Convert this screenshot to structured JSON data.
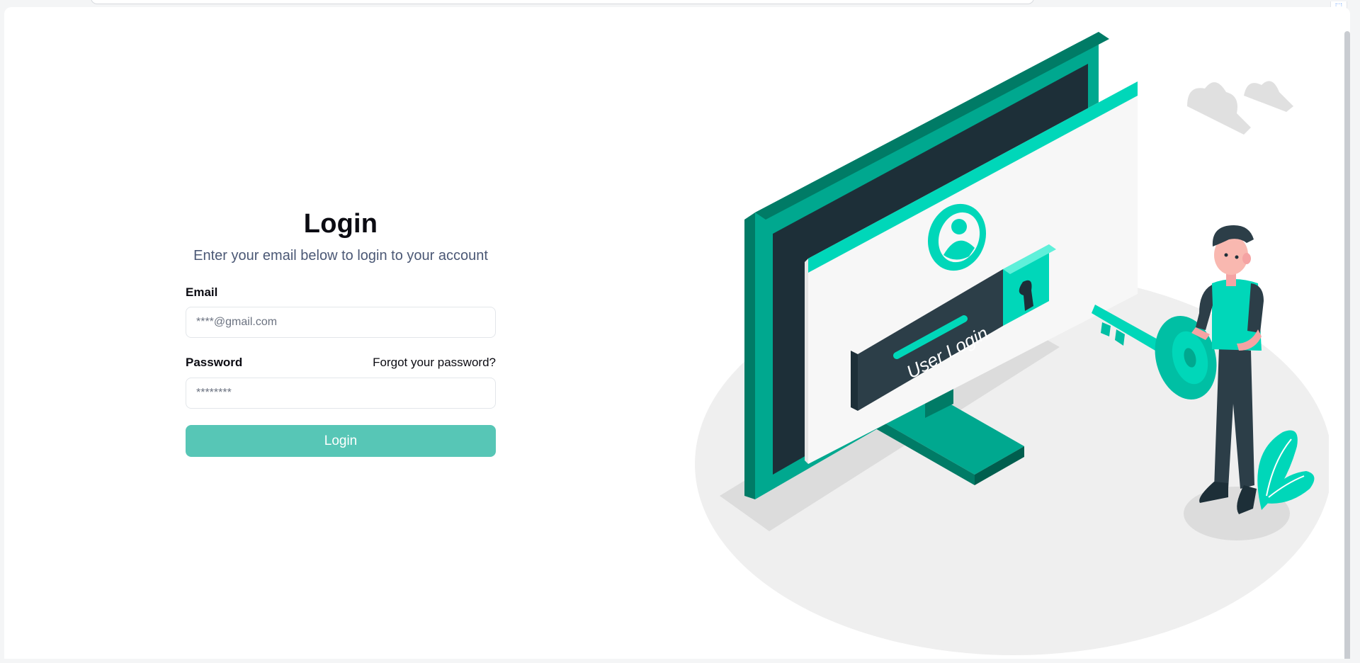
{
  "login": {
    "title": "Login",
    "subtitle": "Enter your email below to login to your account",
    "email_label": "Email",
    "email_placeholder": "****@gmail.com",
    "password_label": "Password",
    "forgot_password": "Forgot your password?",
    "password_placeholder": "********",
    "submit_label": "Login"
  },
  "illustration": {
    "screen_text": "User Login"
  },
  "colors": {
    "accent": "#57c6b6",
    "illustration_teal": "#00d7b9",
    "illustration_dark_teal": "#007b66",
    "monitor_dark": "#1d2f38",
    "text_primary": "#0b0b12",
    "text_muted": "#4b5875"
  }
}
